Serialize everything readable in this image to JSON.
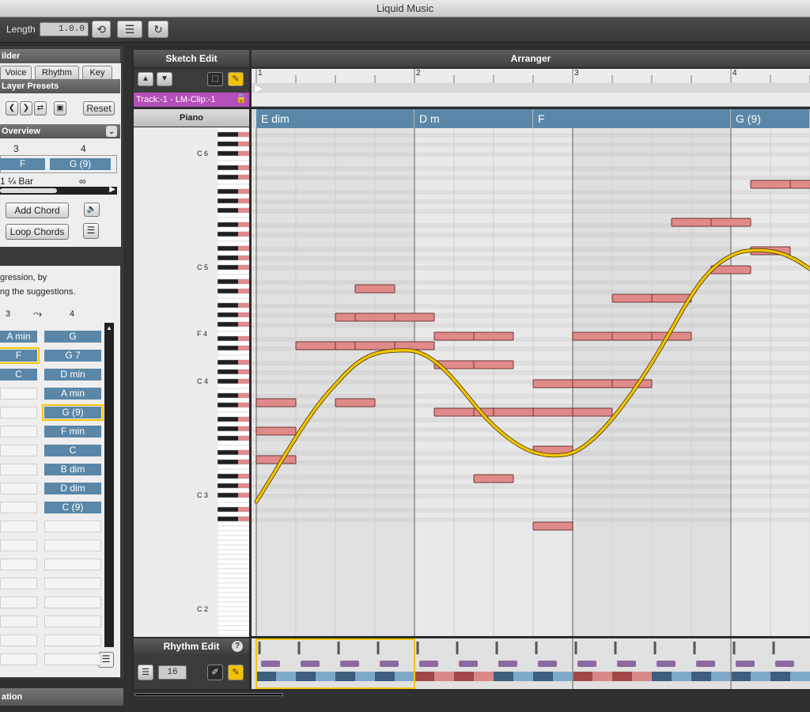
{
  "app": {
    "title": "Liquid Music"
  },
  "toolbar": {
    "length_label": "Length",
    "length_value": "1.0.0"
  },
  "left_panel": {
    "builder_title": "ilder",
    "tabs": [
      "Voice",
      "Rhythm",
      "Key"
    ],
    "layer_presets_title": "Layer Presets",
    "reset_label": "Reset",
    "overview_title": "Overview",
    "overview_cols": [
      "3",
      "4"
    ],
    "overview_chords": [
      "F",
      "G (9)"
    ],
    "bar_length": "1 ¼ Bar",
    "infinity": "∞",
    "add_chord_label": "Add Chord",
    "loop_chords_label": "Loop Chords",
    "instructions_line1": "gression, by",
    "instructions_line2": "ng the suggestions.",
    "suggestion_cols": [
      "3",
      "4"
    ],
    "suggestions_col3": [
      "A min",
      "F",
      "C"
    ],
    "suggestions_col4": [
      "G",
      "G 7",
      "D min",
      "A min",
      "G (9)",
      "F min",
      "C",
      "B dim",
      "D dim",
      "C (9)"
    ],
    "footer_title": "ation"
  },
  "sketch": {
    "title": "Sketch Edit",
    "track_label": "Track:-1 - LM-Clip:-1",
    "instrument_label": "Piano",
    "note_labels": [
      "C 6",
      "C 5",
      "F 4",
      "C 4",
      "C 3",
      "C 2"
    ]
  },
  "arranger": {
    "title": "Arranger",
    "bar_numbers": [
      "1",
      "2",
      "3",
      "4"
    ],
    "chords": [
      "E dim",
      "D m",
      "F",
      "G (9)"
    ]
  },
  "rhythm_edit": {
    "title": "Rhythm Edit",
    "help": "?",
    "grid_value": "16"
  },
  "colors": {
    "chord_blue": "#5a87a8",
    "note_pink": "#e08a8a",
    "contour_yellow": "#f2c200",
    "highlight": "#f4c400"
  }
}
